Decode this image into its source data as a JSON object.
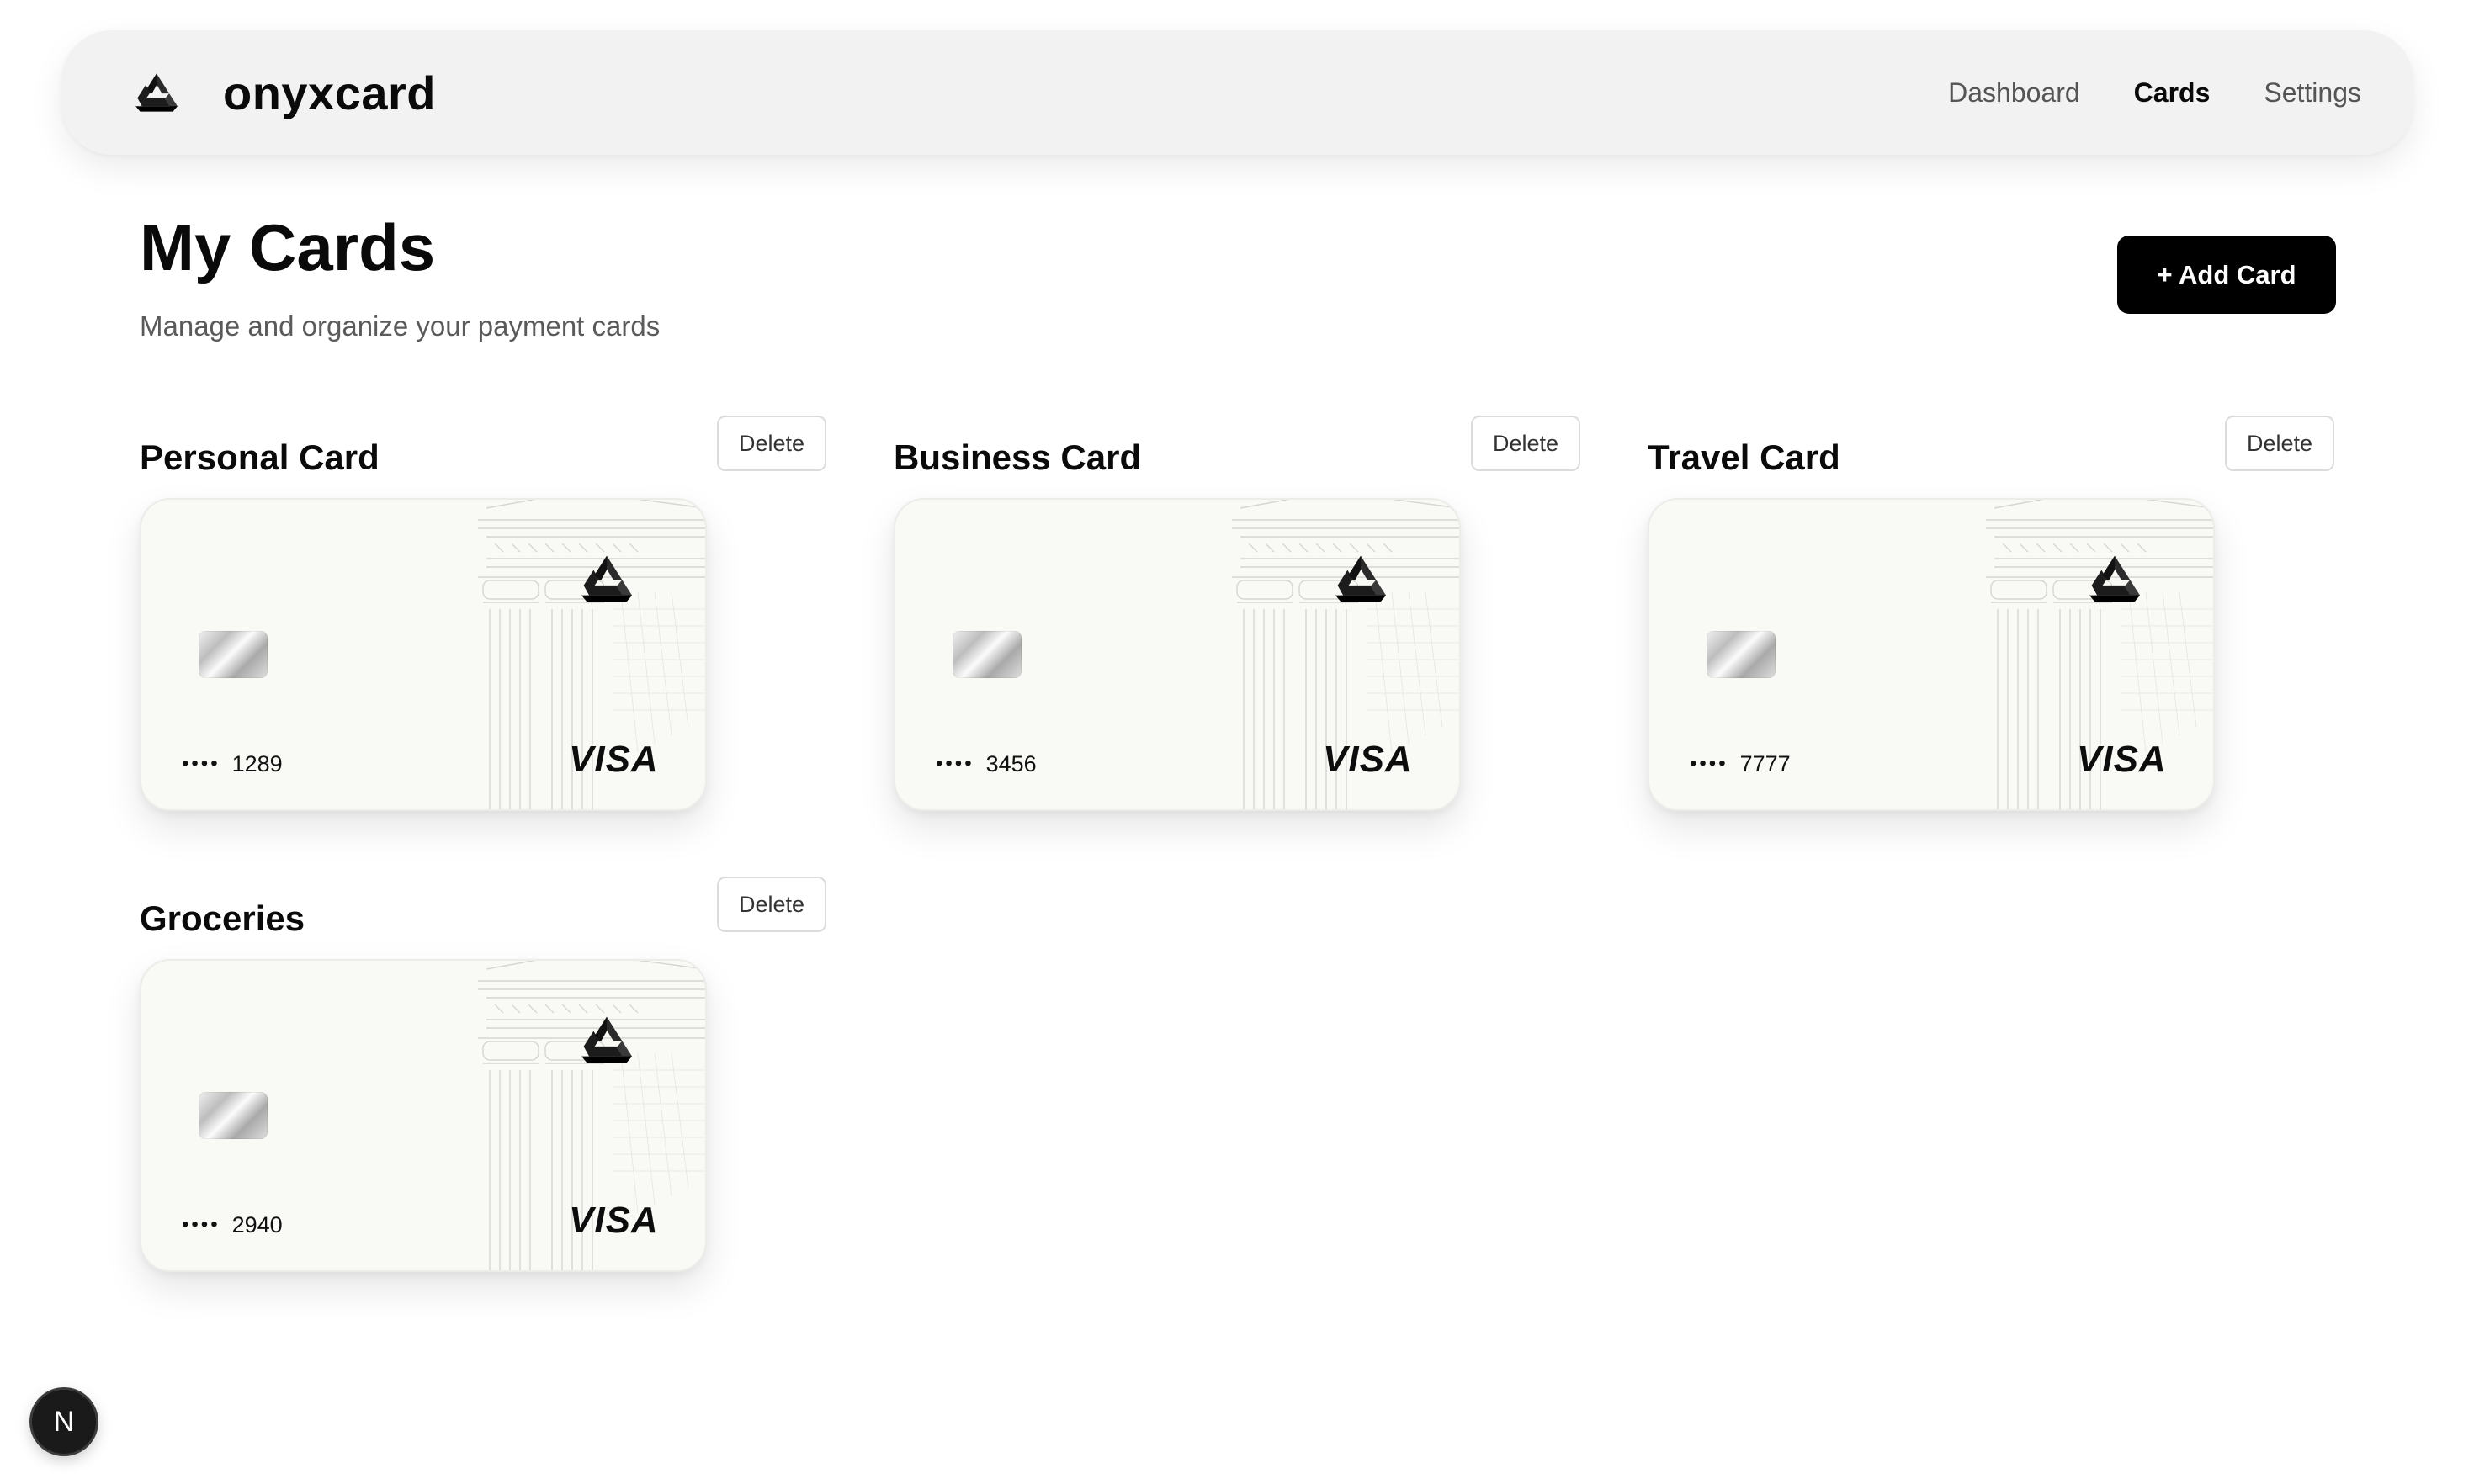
{
  "app": {
    "brand_name": "onyxcard"
  },
  "nav": {
    "links": [
      {
        "label": "Dashboard",
        "active": false
      },
      {
        "label": "Cards",
        "active": true
      },
      {
        "label": "Settings",
        "active": false
      }
    ]
  },
  "page": {
    "title": "My Cards",
    "subtitle": "Manage and organize your payment cards",
    "add_card_label": "+ Add Card"
  },
  "cards": [
    {
      "name": "Personal Card",
      "delete_label": "Delete",
      "masked": "••••",
      "last4": "1289",
      "network": "VISA"
    },
    {
      "name": "Business Card",
      "delete_label": "Delete",
      "masked": "••••",
      "last4": "3456",
      "network": "VISA"
    },
    {
      "name": "Travel Card",
      "delete_label": "Delete",
      "masked": "••••",
      "last4": "7777",
      "network": "VISA"
    },
    {
      "name": "Groceries",
      "delete_label": "Delete",
      "masked": "••••",
      "last4": "2940",
      "network": "VISA"
    }
  ],
  "dev_badge": {
    "letter": "N"
  },
  "icons": {
    "brand": "onyx-triangle-logo-icon",
    "card_chip": "card-chip-icon",
    "card_art": "classical-building-art"
  },
  "colors": {
    "primary": "#000000",
    "navbar_bg": "#f2f2f2",
    "card_bg": "#f9f9f5",
    "muted_text": "#5a5a5a"
  }
}
